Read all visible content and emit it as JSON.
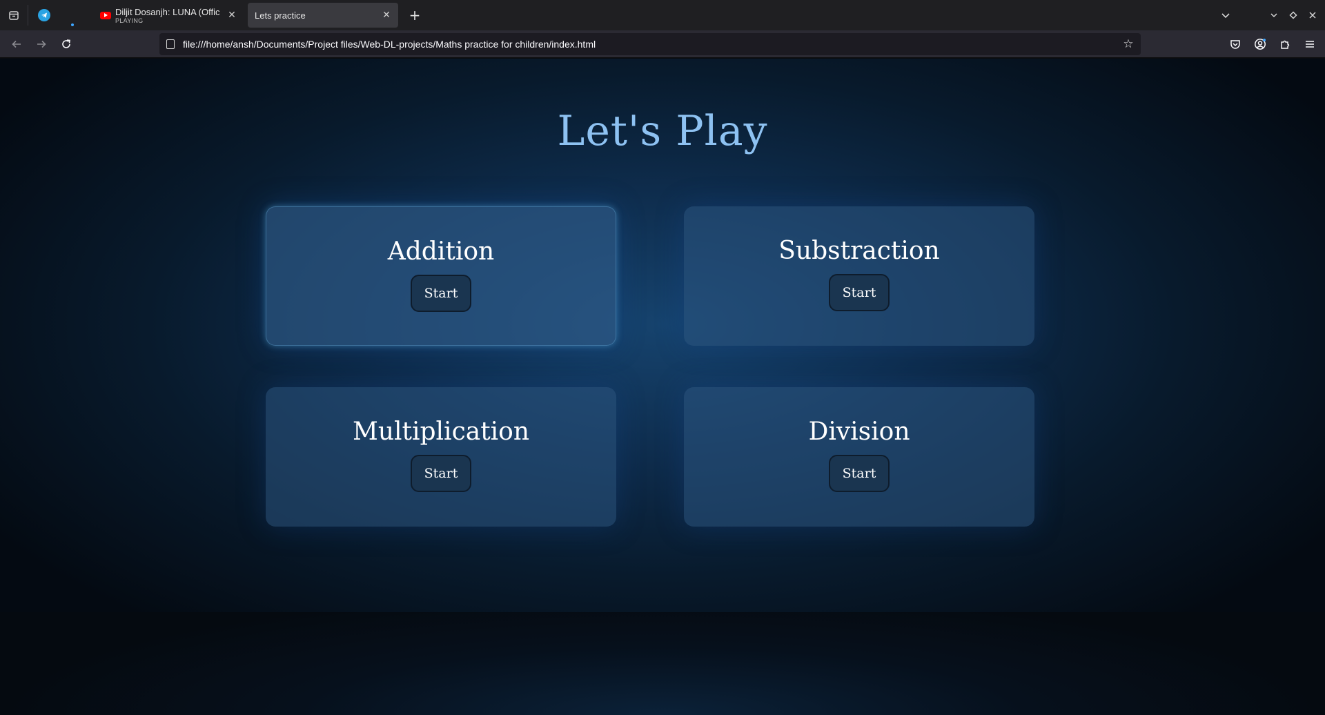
{
  "browser": {
    "pinned_tab_icon": "telegram-icon",
    "tabs": [
      {
        "title": "Diljit Dosanjh: LUNA (Offic",
        "subtitle": "PLAYING",
        "icon": "youtube-icon",
        "active": false
      },
      {
        "title": "Lets practice",
        "subtitle": "",
        "icon": "",
        "active": true
      }
    ],
    "url": "file:///home/ansh/Documents/Project files/Web-DL-projects/Maths practice for children/index.html"
  },
  "page": {
    "title": "Let's Play",
    "cards": [
      {
        "title": "Addition",
        "button": "Start"
      },
      {
        "title": "Substraction",
        "button": "Start"
      },
      {
        "title": "Multiplication",
        "button": "Start"
      },
      {
        "title": "Division",
        "button": "Start"
      }
    ]
  }
}
